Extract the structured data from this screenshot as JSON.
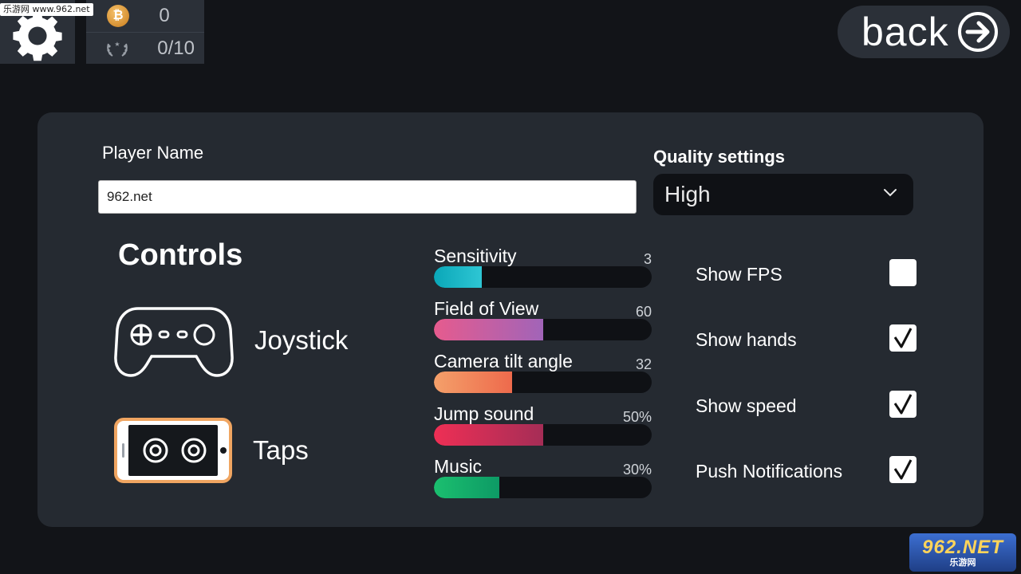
{
  "watermark_top": "乐游网 www.962.net",
  "stats": {
    "coins": "0",
    "achievements": "0/10"
  },
  "back_label": "back",
  "settings": {
    "player_name_label": "Player Name",
    "player_name_value": "962.net",
    "quality_label": "Quality settings",
    "quality_value": "High"
  },
  "controls": {
    "title": "Controls",
    "options": [
      {
        "label": "Joystick",
        "icon": "gamepad-icon",
        "selected": false
      },
      {
        "label": "Taps",
        "icon": "phone-tap-icon",
        "selected": true
      }
    ]
  },
  "sliders": [
    {
      "label": "Sensitivity",
      "value": "3",
      "fill_fraction": 0.22,
      "color_from": "#0aa7b8",
      "color_to": "#2ec6d4"
    },
    {
      "label": "Field of View",
      "value": "60",
      "fill_fraction": 0.5,
      "color_from": "#e65b8e",
      "color_to": "#a164b8"
    },
    {
      "label": "Camera tilt angle",
      "value": "32",
      "fill_fraction": 0.36,
      "color_from": "#f4a06a",
      "color_to": "#ee6a4c"
    },
    {
      "label": "Jump sound",
      "value": "50%",
      "fill_fraction": 0.5,
      "color_from": "#ee2f55",
      "color_to": "#a52d56"
    },
    {
      "label": "Music",
      "value": "30%",
      "fill_fraction": 0.3,
      "color_from": "#1bbf6f",
      "color_to": "#0d9a65"
    }
  ],
  "toggles": [
    {
      "label": "Show FPS",
      "checked": false
    },
    {
      "label": "Show hands",
      "checked": true
    },
    {
      "label": "Show speed",
      "checked": true
    },
    {
      "label": "Push Notifications",
      "checked": true
    }
  ],
  "watermark_logo": {
    "big": "962.NET",
    "small": "乐游网"
  },
  "colors": {
    "panel": "#252a31",
    "background": "#121418",
    "tap_highlight": "#f0a561"
  }
}
